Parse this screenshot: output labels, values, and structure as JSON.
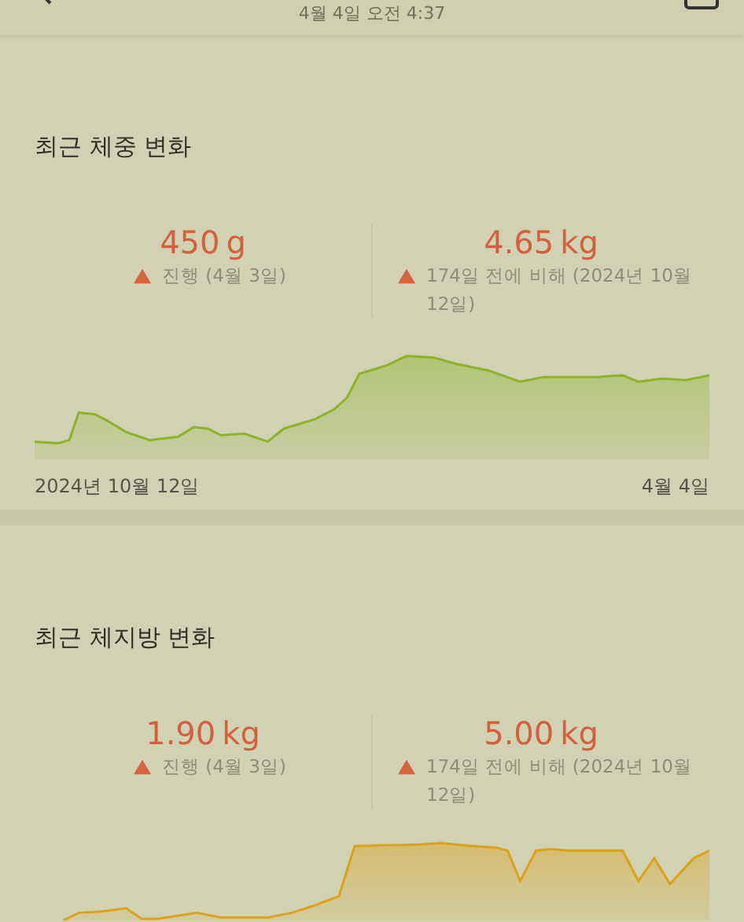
{
  "header": {
    "subtitle": "4월 4일 오전 4:37"
  },
  "sections": [
    {
      "title": "최근 체중 변화",
      "stats": [
        {
          "value": "450",
          "unit": "g",
          "increase": true,
          "note": "진행 (4월 3일)"
        },
        {
          "value": "4.65",
          "unit": "kg",
          "increase": true,
          "note": "174일 전에 비해 (2024년 10월 12일)"
        }
      ],
      "chart": {
        "kind": "green"
      },
      "start_label": "2024년 10월 12일",
      "end_label": "4월 4일"
    },
    {
      "title": "최근 체지방 변화",
      "stats": [
        {
          "value": "1.90",
          "unit": "kg",
          "increase": true,
          "note": "진행 (4월 3일)"
        },
        {
          "value": "5.00",
          "unit": "kg",
          "increase": true,
          "note": "174일 전에 비해 (2024년 10월 12일)"
        }
      ],
      "chart": {
        "kind": "orange"
      }
    }
  ]
}
